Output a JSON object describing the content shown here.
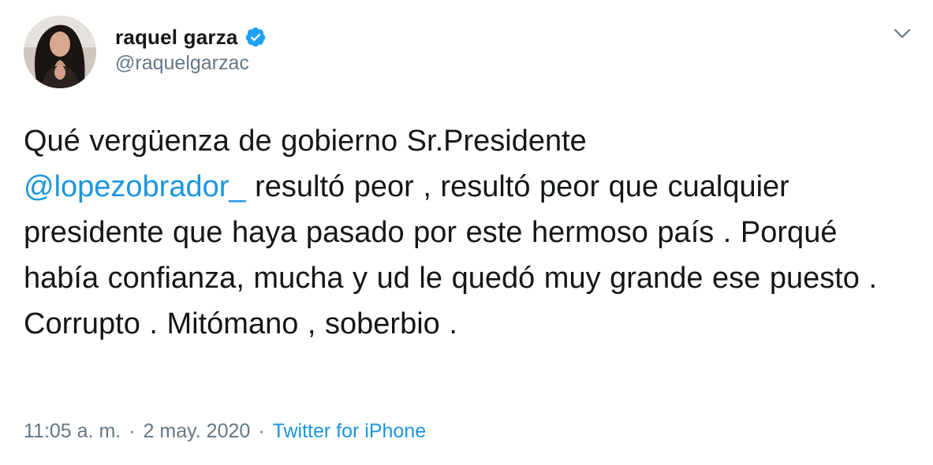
{
  "user": {
    "display_name": "raquel garza",
    "handle": "@raquelgarzac",
    "verified": true
  },
  "tweet": {
    "text_before": "Qué vergüenza de gobierno Sr.Presidente",
    "mention": "@lopezobrador_",
    "text_after": " resultó peor , resultó peor que cualquier presidente que haya pasado por este hermoso país . Porqué había confianza, mucha y ud le quedó muy grande ese puesto . Corrupto . Mitómano , soberbio .",
    "time": "11:05 a. m.",
    "separator": "·",
    "date": "2 may. 2020",
    "source": "Twitter for iPhone"
  },
  "icons": {
    "verified": "verified-badge-icon",
    "caret": "chevron-down-icon"
  },
  "colors": {
    "link": "#1b95e0",
    "muted": "#657786",
    "text": "#14171a",
    "verified": "#1da1f2"
  }
}
